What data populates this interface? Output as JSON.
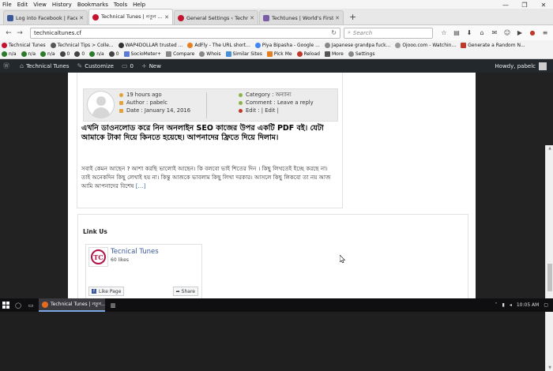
{
  "menubar": {
    "items": [
      "File",
      "Edit",
      "View",
      "History",
      "Bookmarks",
      "Tools",
      "Help"
    ]
  },
  "window_controls": {
    "minimize": "—",
    "restore": "❐",
    "close": "✕"
  },
  "tabs": [
    {
      "label": "Log into Facebook | Faceb...",
      "color": "#3b5998",
      "active": false
    },
    {
      "label": "Technical Tunes | নতুন ...",
      "color": "#c4122f",
      "active": true
    },
    {
      "label": "General Settings ‹ Technic...",
      "color": "#c4122f",
      "active": false
    },
    {
      "label": "Techtunes | World's First, ...",
      "color": "#7a5ca8",
      "active": false
    }
  ],
  "newtab_label": "+",
  "nav": {
    "back": "←",
    "forward": "→",
    "url": "technicaltunes.cf",
    "reload": "↻",
    "search_placeholder": "Search",
    "icons": [
      "☆",
      "▤",
      "⬇",
      "⌂",
      "✉",
      "☺",
      "▶",
      "●",
      "≡"
    ]
  },
  "bookmarks_row1": [
    {
      "label": "Technical Tunes",
      "color": "#c4122f"
    },
    {
      "label": "Technical Tips > Colle...",
      "color": "#555"
    },
    {
      "label": "WAP4DOLLAR trusted ...",
      "color": "#333"
    },
    {
      "label": "AdFly - The URL short...",
      "color": "#e67e22"
    },
    {
      "label": "Piya Bipasha - Google ...",
      "color": "#4285f4"
    },
    {
      "label": "Japanese grandpa fuck...",
      "color": "#888"
    },
    {
      "label": "Ojooo.com - Watchin...",
      "color": "#999"
    },
    {
      "label": "Generate a Random N...",
      "color": "#c0392b"
    }
  ],
  "bookmarks_row2": [
    {
      "label": "n/a",
      "color": "#2c7a2c"
    },
    {
      "label": "n/a",
      "color": "#2c7a2c"
    },
    {
      "label": "n/a",
      "color": "#2c7a2c"
    },
    {
      "label": "0",
      "color": "#444"
    },
    {
      "label": "0",
      "color": "#444"
    },
    {
      "label": "n/a",
      "color": "#2c7a2c"
    },
    {
      "label": "0",
      "color": "#444"
    },
    {
      "label": "SocioMeter+",
      "color": "#5b7bd5"
    },
    {
      "label": "Compare",
      "color": "#888"
    },
    {
      "label": "Whois",
      "color": "#888"
    },
    {
      "label": "Similar Sites",
      "color": "#4a90d9"
    },
    {
      "label": "Pick Me",
      "color": "#e67e22"
    },
    {
      "label": "Reload",
      "color": "#c0392b"
    },
    {
      "label": "More",
      "color": "#555"
    },
    {
      "label": "Settings",
      "color": "#888"
    }
  ],
  "wpbar": {
    "site_name": "Technical Tunes",
    "customize": "Customize",
    "comments": "0",
    "new": "New",
    "howdy": "Howdy, pabelc"
  },
  "post": {
    "time": "19 hours ago",
    "author_label": "Author :",
    "author": "pabelc",
    "date_label": "Date :",
    "date": "January 14, 2016",
    "category_label": "Category :",
    "category": "অন্যান্য",
    "comment_label": "Comment :",
    "comment": "Leave a reply",
    "edit_label": "Edit :",
    "edit": "| Edit |",
    "title": "এখনি ডাওনলোড করে নিন অনলাইন SEO কাজের উপর একটি PDF বই। যেটা আমাকে টাকা দিয়ে কিনতে হয়েছে। আপনাদের ফ্রিতে দিয়ে দিলাম।",
    "excerpt": "সবাই কেমন আছেন ? আশা করছি ভালোই আছেন। কি বলবো ভাই শিতের দিন । কিছু লিখতেই ইচ্ছে করছে না। তাই অনেকদিন কিছু লেখাই হয় না। কিন্তু আজকে ভাবলাম কিছু লিখা দরকার। আসলে কিছু লিকবো তা নয় আজ আমি আপনাদের বিশেষ",
    "more": "[…]"
  },
  "widget": {
    "title": "Link Us",
    "fb_logo": "TC",
    "fb_name": "Tecnical Tunes",
    "fb_likes": "60 likes",
    "like_button": "Like Page",
    "share_button": "Share"
  },
  "taskbar": {
    "app_label": "Technical Tunes | নতুন...",
    "time": "10:05 AM"
  }
}
